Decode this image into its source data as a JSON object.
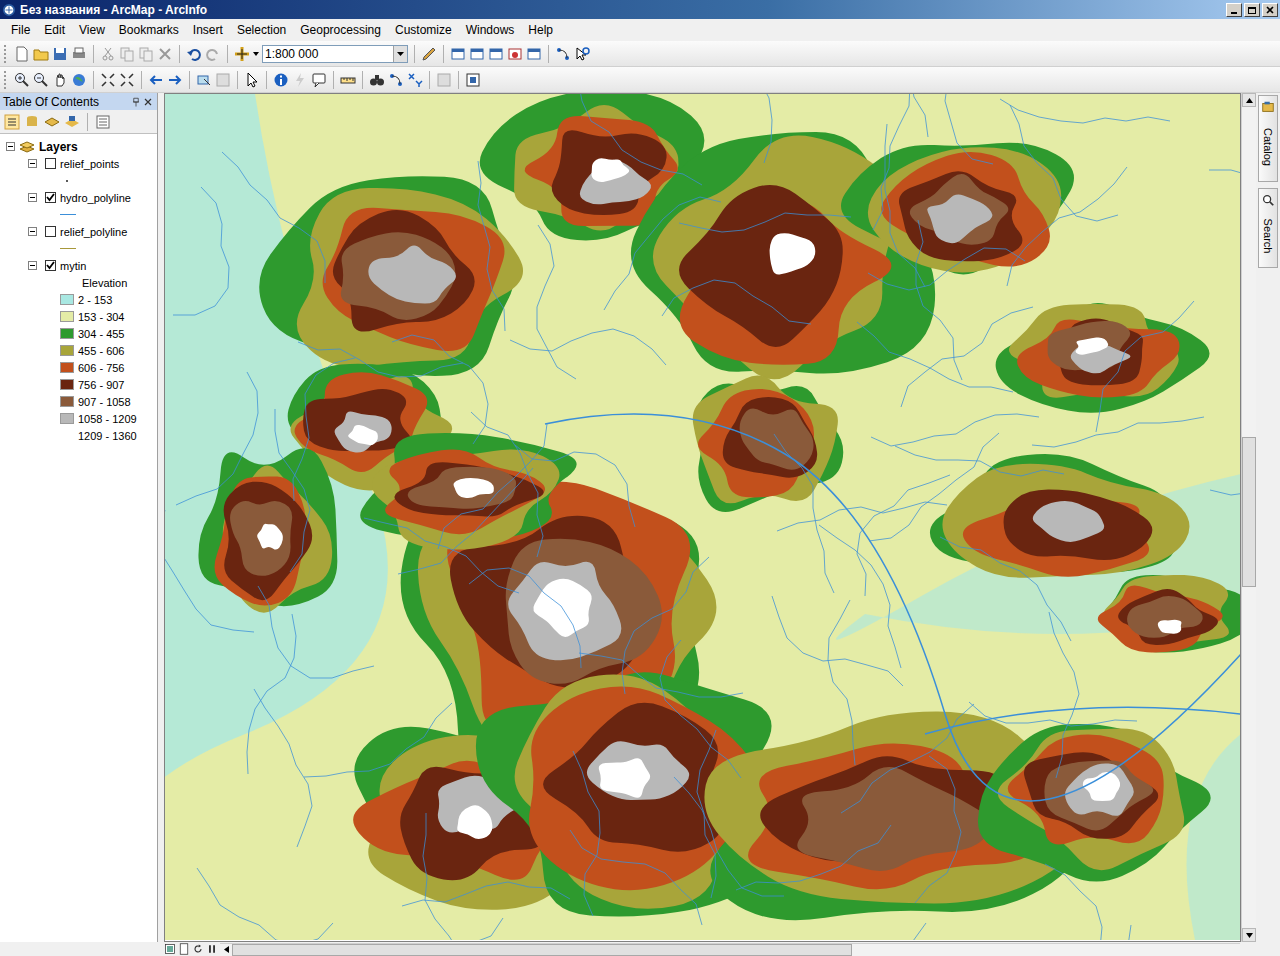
{
  "window": {
    "title": "Без названия - ArcMap - ArcInfo"
  },
  "menu": [
    "File",
    "Edit",
    "View",
    "Bookmarks",
    "Insert",
    "Selection",
    "Geoprocessing",
    "Customize",
    "Windows",
    "Help"
  ],
  "toolbar": {
    "scale": "1:800 000"
  },
  "toc": {
    "title": "Table Of Contents",
    "root": {
      "label": "Layers",
      "expanded": true
    },
    "layers": [
      {
        "name": "relief_points",
        "checked": false,
        "expanded": true,
        "kind": "point",
        "color": "#5a5a5a"
      },
      {
        "name": "hydro_polyline",
        "checked": true,
        "expanded": true,
        "kind": "line",
        "color": "#3b8fd9"
      },
      {
        "name": "relief_polyline",
        "checked": false,
        "expanded": true,
        "kind": "line",
        "color": "#a8983a"
      },
      {
        "name": "mytin",
        "checked": true,
        "expanded": true,
        "kind": "tin",
        "legend": {
          "field": "Elevation",
          "classes": [
            {
              "label": "2 - 153",
              "color": "#a9e8e2"
            },
            {
              "label": "153 - 304",
              "color": "#e4eca6"
            },
            {
              "label": "304 - 455",
              "color": "#2e9a2e"
            },
            {
              "label": "455 - 606",
              "color": "#a8a53a"
            },
            {
              "label": "606 - 756",
              "color": "#c2501c"
            },
            {
              "label": "756 - 907",
              "color": "#6a2510"
            },
            {
              "label": "907 - 1058",
              "color": "#8a5a3a"
            },
            {
              "label": "1058 - 1209",
              "color": "#b8b8b8"
            },
            {
              "label": "1209 - 1360",
              "color": "#ffffff"
            }
          ]
        }
      }
    ]
  },
  "side_tabs": [
    "Catalog",
    "Search"
  ]
}
